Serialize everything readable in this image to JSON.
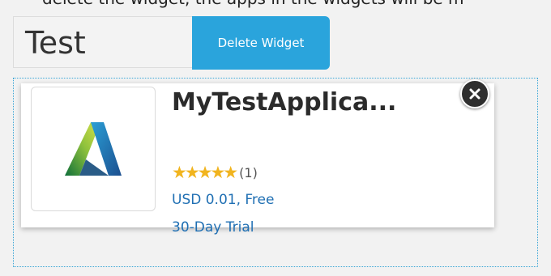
{
  "header": {
    "instruction_fragment": "delete the widget, the apps in the widgets will be m"
  },
  "widget": {
    "name_value": "Test",
    "delete_label": "Delete Widget"
  },
  "app": {
    "title": "MyTestApplica...",
    "stars": "★★★★★",
    "rating_count": "(1)",
    "price": "USD 0.01, Free",
    "trial": "30-Day Trial",
    "logo_icon": "autodesk-logo-icon",
    "close_icon": "close-icon"
  },
  "colors": {
    "accent": "#2aa4dc",
    "star": "#f1b41e",
    "link": "#1f6fb3"
  }
}
